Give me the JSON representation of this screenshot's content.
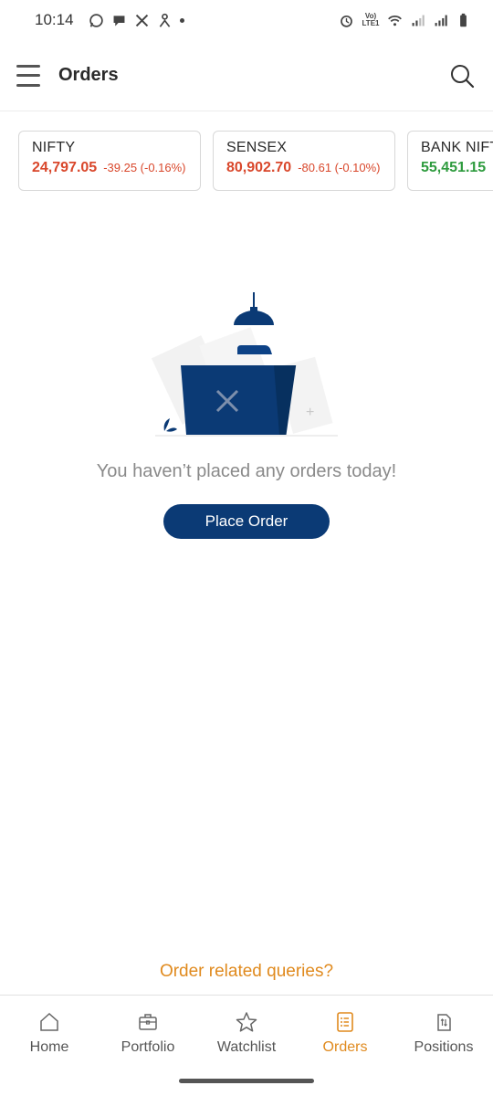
{
  "status_bar": {
    "time": "10:14",
    "left_icons": [
      "whatsapp-icon",
      "chat-bubble-icon",
      "x-icon",
      "person-icon",
      "dot-icon"
    ],
    "right_icons": [
      "alarm-icon",
      "volte-icon",
      "wifi-icon",
      "signal-icon",
      "signal-icon",
      "battery-icon"
    ],
    "volte_label": "Vo) LTE1"
  },
  "header": {
    "title": "Orders",
    "menu_icon": "hamburger-menu-icon",
    "search_icon": "search-icon"
  },
  "indices": [
    {
      "name": "NIFTY",
      "price": "24,797.05",
      "change": "-39.25 (-0.16%)",
      "trend": "negative"
    },
    {
      "name": "SENSEX",
      "price": "80,902.70",
      "change": "-80.61 (-0.10%)",
      "trend": "negative"
    },
    {
      "name": "BANK NIFTY",
      "price": "55,451.15",
      "change": "",
      "trend": "positive"
    }
  ],
  "empty_state": {
    "illustration_icon": "empty-folder-lamp-illustration",
    "message": "You haven’t placed any orders today!",
    "button_label": "Place Order"
  },
  "queries_link": "Order related queries?",
  "bottom_nav": [
    {
      "label": "Home",
      "icon": "home-icon",
      "active": false
    },
    {
      "label": "Portfolio",
      "icon": "briefcase-icon",
      "active": false
    },
    {
      "label": "Watchlist",
      "icon": "star-icon",
      "active": false
    },
    {
      "label": "Orders",
      "icon": "orders-list-icon",
      "active": true
    },
    {
      "label": "Positions",
      "icon": "positions-icon",
      "active": false
    }
  ],
  "colors": {
    "accent": "#e08a1e",
    "primary_button": "#0b3a75",
    "negative": "#d9472b",
    "positive": "#2e9b3e"
  }
}
